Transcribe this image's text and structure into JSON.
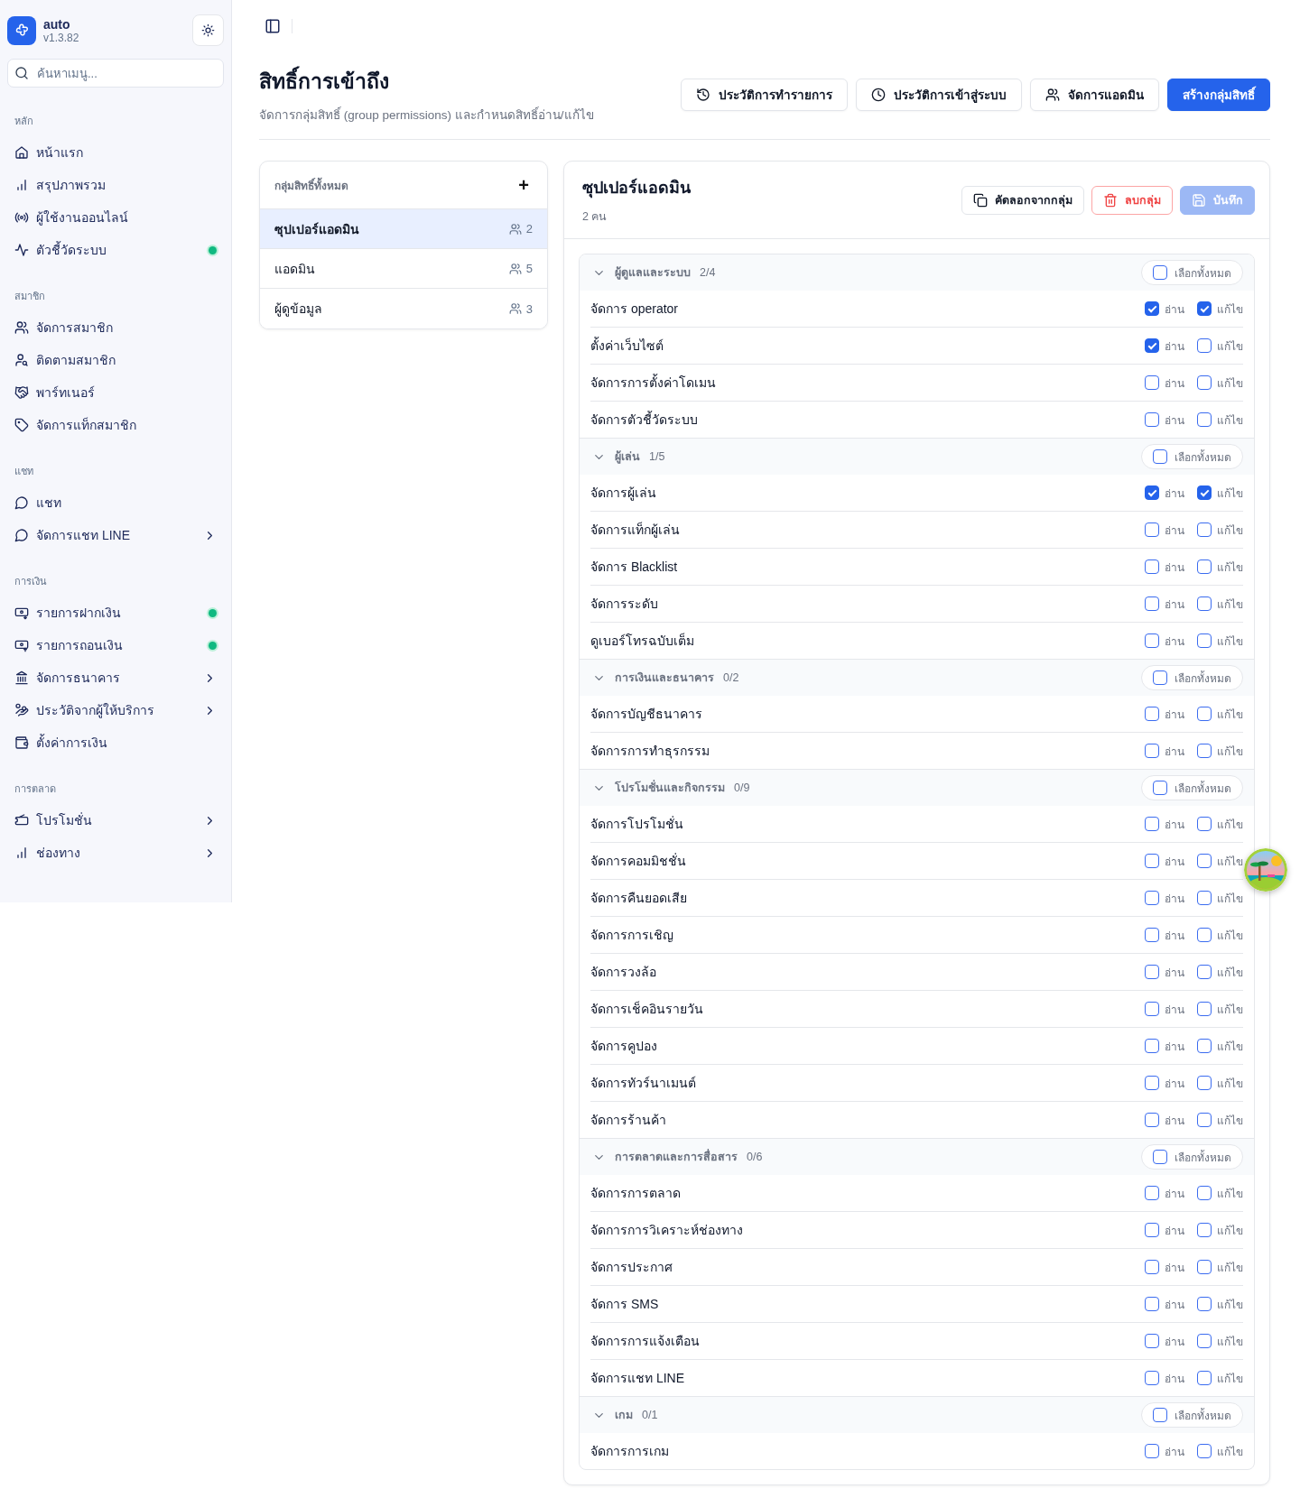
{
  "app": {
    "name": "auto",
    "version": "v1.3.82"
  },
  "search": {
    "placeholder": "ค้นหาเมนู..."
  },
  "sidebar": [
    {
      "title": "หลัก",
      "items": [
        {
          "label": "หน้าแรก",
          "alert": false,
          "expandable": false
        },
        {
          "label": "สรุปภาพรวม",
          "alert": false,
          "expandable": false
        },
        {
          "label": "ผู้ใช้งานออนไลน์",
          "alert": false,
          "expandable": false
        },
        {
          "label": "ตัวชี้วัดระบบ",
          "alert": true,
          "expandable": false
        }
      ]
    },
    {
      "title": "สมาชิก",
      "items": [
        {
          "label": "จัดการสมาชิก",
          "alert": false,
          "expandable": false
        },
        {
          "label": "ติดตามสมาชิก",
          "alert": false,
          "expandable": false
        },
        {
          "label": "พาร์ทเนอร์",
          "alert": false,
          "expandable": false
        },
        {
          "label": "จัดการแท็กสมาชิก",
          "alert": false,
          "expandable": false
        }
      ]
    },
    {
      "title": "แชท",
      "items": [
        {
          "label": "แชท",
          "alert": false,
          "expandable": false
        },
        {
          "label": "จัดการแชท LINE",
          "alert": false,
          "expandable": true
        }
      ]
    },
    {
      "title": "การเงิน",
      "items": [
        {
          "label": "รายการฝากเงิน",
          "alert": true,
          "expandable": false
        },
        {
          "label": "รายการถอนเงิน",
          "alert": true,
          "expandable": false
        },
        {
          "label": "จัดการธนาคาร",
          "alert": false,
          "expandable": true
        },
        {
          "label": "ประวัติจากผู้ให้บริการ",
          "alert": false,
          "expandable": true
        },
        {
          "label": "ตั้งค่าการเงิน",
          "alert": false,
          "expandable": false
        }
      ]
    },
    {
      "title": "การตลาด",
      "items": [
        {
          "label": "โปรโมชั่น",
          "alert": false,
          "expandable": true
        },
        {
          "label": "ช่องทาง",
          "alert": false,
          "expandable": true
        }
      ]
    }
  ],
  "page": {
    "title": "สิทธิ์การเข้าถึง",
    "subtitle": "จัดการกลุ่มสิทธิ์ (group permissions) และกำหนดสิทธิ์อ่าน/แก้ไข"
  },
  "header_buttons": [
    {
      "label": "ประวัติการทำรายการ",
      "kind": "history"
    },
    {
      "label": "ประวัติการเข้าสู่ระบบ",
      "kind": "clock"
    },
    {
      "label": "จัดการแอดมิน",
      "kind": "users"
    },
    {
      "label": "สร้างกลุ่มสิทธิ์",
      "kind": "primary"
    }
  ],
  "group_list": {
    "title": "กลุ่มสิทธิ์ทั้งหมด",
    "add": "+",
    "groups": [
      {
        "name": "ซุปเปอร์แอดมิน",
        "count": "2",
        "selected": true
      },
      {
        "name": "แอดมิน",
        "count": "5",
        "selected": false
      },
      {
        "name": "ผู้ดูข้อมูล",
        "count": "3",
        "selected": false
      }
    ]
  },
  "detail": {
    "title": "ซุปเปอร์แอดมิน",
    "members": "2 คน",
    "actions": [
      {
        "label": "คัดลอกจากกลุ่ม",
        "kind": "copy",
        "disabled": false
      },
      {
        "label": "ลบกลุ่ม",
        "kind": "delete",
        "disabled": false
      },
      {
        "label": "บันทึก",
        "kind": "save",
        "disabled": true
      }
    ],
    "sections": [
      {
        "title": "ผู้ดูแลและระบบ",
        "count": "2/4",
        "expanded": true,
        "select_all": {
          "label": "เลือกทั้งหมด",
          "checked": false
        },
        "permissions": [
          {
            "name": "จัดการ operator",
            "read_label": "อ่าน",
            "read": true,
            "edit_label": "แก้ไข",
            "edit": true
          },
          {
            "name": "ตั้งค่าเว็บไซต์",
            "read_label": "อ่าน",
            "read": true,
            "edit_label": "แก้ไข",
            "edit": false
          },
          {
            "name": "จัดการการตั้งค่าโดเมน",
            "read_label": "อ่าน",
            "read": false,
            "edit_label": "แก้ไข",
            "edit": false
          },
          {
            "name": "จัดการตัวชี้วัดระบบ",
            "read_label": "อ่าน",
            "read": false,
            "edit_label": "แก้ไข",
            "edit": false
          }
        ]
      },
      {
        "title": "ผู้เล่น",
        "count": "1/5",
        "expanded": true,
        "select_all": {
          "label": "เลือกทั้งหมด",
          "checked": false
        },
        "permissions": [
          {
            "name": "จัดการผู้เล่น",
            "read_label": "อ่าน",
            "read": true,
            "edit_label": "แก้ไข",
            "edit": true
          },
          {
            "name": "จัดการแท็กผู้เล่น",
            "read_label": "อ่าน",
            "read": false,
            "edit_label": "แก้ไข",
            "edit": false
          },
          {
            "name": "จัดการ Blacklist",
            "read_label": "อ่าน",
            "read": false,
            "edit_label": "แก้ไข",
            "edit": false
          },
          {
            "name": "จัดการระดับ",
            "read_label": "อ่าน",
            "read": false,
            "edit_label": "แก้ไข",
            "edit": false
          },
          {
            "name": "ดูเบอร์โทรฉบับเต็ม",
            "read_label": "อ่าน",
            "read": false,
            "edit_label": "แก้ไข",
            "edit": false
          }
        ]
      },
      {
        "title": "การเงินและธนาคาร",
        "count": "0/2",
        "expanded": true,
        "select_all": {
          "label": "เลือกทั้งหมด",
          "checked": false
        },
        "permissions": [
          {
            "name": "จัดการบัญชีธนาคาร",
            "read_label": "อ่าน",
            "read": false,
            "edit_label": "แก้ไข",
            "edit": false
          },
          {
            "name": "จัดการการทำธุรกรรม",
            "read_label": "อ่าน",
            "read": false,
            "edit_label": "แก้ไข",
            "edit": false
          }
        ]
      },
      {
        "title": "โปรโมชั่นและกิจกรรม",
        "count": "0/9",
        "expanded": true,
        "select_all": {
          "label": "เลือกทั้งหมด",
          "checked": false
        },
        "permissions": [
          {
            "name": "จัดการโปรโมชั่น",
            "read_label": "อ่าน",
            "read": false,
            "edit_label": "แก้ไข",
            "edit": false
          },
          {
            "name": "จัดการคอมมิชชั่น",
            "read_label": "อ่าน",
            "read": false,
            "edit_label": "แก้ไข",
            "edit": false
          },
          {
            "name": "จัดการคืนยอดเสีย",
            "read_label": "อ่าน",
            "read": false,
            "edit_label": "แก้ไข",
            "edit": false
          },
          {
            "name": "จัดการการเชิญ",
            "read_label": "อ่าน",
            "read": false,
            "edit_label": "แก้ไข",
            "edit": false
          },
          {
            "name": "จัดการวงล้อ",
            "read_label": "อ่าน",
            "read": false,
            "edit_label": "แก้ไข",
            "edit": false
          },
          {
            "name": "จัดการเช็คอินรายวัน",
            "read_label": "อ่าน",
            "read": false,
            "edit_label": "แก้ไข",
            "edit": false
          },
          {
            "name": "จัดการคูปอง",
            "read_label": "อ่าน",
            "read": false,
            "edit_label": "แก้ไข",
            "edit": false
          },
          {
            "name": "จัดการทัวร์นาเมนต์",
            "read_label": "อ่าน",
            "read": false,
            "edit_label": "แก้ไข",
            "edit": false
          },
          {
            "name": "จัดการร้านค้า",
            "read_label": "อ่าน",
            "read": false,
            "edit_label": "แก้ไข",
            "edit": false
          }
        ]
      },
      {
        "title": "การตลาดและการสื่อสาร",
        "count": "0/6",
        "expanded": true,
        "select_all": {
          "label": "เลือกทั้งหมด",
          "checked": false
        },
        "permissions": [
          {
            "name": "จัดการการตลาด",
            "read_label": "อ่าน",
            "read": false,
            "edit_label": "แก้ไข",
            "edit": false
          },
          {
            "name": "จัดการการวิเคราะห์ช่องทาง",
            "read_label": "อ่าน",
            "read": false,
            "edit_label": "แก้ไข",
            "edit": false
          },
          {
            "name": "จัดการประกาศ",
            "read_label": "อ่าน",
            "read": false,
            "edit_label": "แก้ไข",
            "edit": false
          },
          {
            "name": "จัดการ SMS",
            "read_label": "อ่าน",
            "read": false,
            "edit_label": "แก้ไข",
            "edit": false
          },
          {
            "name": "จัดการการแจ้งเตือน",
            "read_label": "อ่าน",
            "read": false,
            "edit_label": "แก้ไข",
            "edit": false
          },
          {
            "name": "จัดการแชท LINE",
            "read_label": "อ่าน",
            "read": false,
            "edit_label": "แก้ไข",
            "edit": false
          }
        ]
      },
      {
        "title": "เกม",
        "count": "0/1",
        "expanded": true,
        "select_all": {
          "label": "เลือกทั้งหมด",
          "checked": false
        },
        "permissions": [
          {
            "name": "จัดการการเกม",
            "read_label": "อ่าน",
            "read": false,
            "edit_label": "แก้ไข",
            "edit": false
          }
        ]
      }
    ]
  }
}
